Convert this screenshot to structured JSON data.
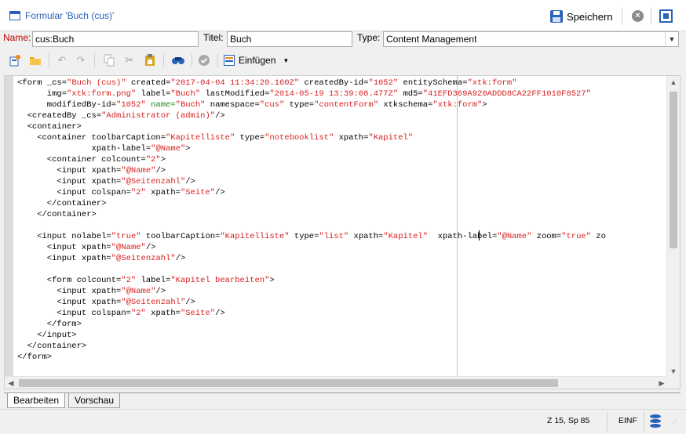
{
  "window": {
    "title": "Formular 'Buch (cus)'",
    "save_label": "Speichern",
    "icons": [
      "form-window-icon",
      "save-icon",
      "close-circle-icon",
      "fit-window-icon"
    ]
  },
  "fields": {
    "name_label": "Name:",
    "name_value": "cus:Buch",
    "title_label": "Titel:",
    "title_value": "Buch",
    "type_label": "Type:",
    "type_value": "Content Management"
  },
  "toolbar": {
    "insert_label": "Einfügen",
    "icons": [
      "new-element-icon",
      "open-folder-icon",
      "undo-icon",
      "redo-icon",
      "copy-icon",
      "cut-icon",
      "paste-icon",
      "find-icon",
      "validate-icon",
      "insert-icon",
      "dropdown-arrow-icon"
    ]
  },
  "code_lines": [
    [
      {
        "t": "<form _cs=",
        "c": "k"
      },
      {
        "t": "\"Buch (cus)\"",
        "c": "s"
      },
      {
        "t": " created=",
        "c": "k"
      },
      {
        "t": "\"2017-04-04 11:34:20.160Z\"",
        "c": "s"
      },
      {
        "t": " createdBy-id=",
        "c": "k"
      },
      {
        "t": "\"1052\"",
        "c": "s"
      },
      {
        "t": " entitySchema=",
        "c": "k"
      },
      {
        "t": "\"xtk:form\"",
        "c": "s"
      }
    ],
    [
      {
        "t": "      img=",
        "c": "k"
      },
      {
        "t": "\"xtk:form.png\"",
        "c": "s"
      },
      {
        "t": " label=",
        "c": "k"
      },
      {
        "t": "\"Buch\"",
        "c": "s"
      },
      {
        "t": " lastModified=",
        "c": "k"
      },
      {
        "t": "\"2014-05-19 13:39:08.477Z\"",
        "c": "s"
      },
      {
        "t": " md5=",
        "c": "k"
      },
      {
        "t": "\"41EFD369A920ADDD8CA22FF1010F8527\"",
        "c": "s"
      }
    ],
    [
      {
        "t": "      modifiedBy-id=",
        "c": "k"
      },
      {
        "t": "\"1052\"",
        "c": "s"
      },
      {
        "t": " name=",
        "c": "g"
      },
      {
        "t": "\"Buch\"",
        "c": "s"
      },
      {
        "t": " namespace=",
        "c": "k"
      },
      {
        "t": "\"cus\"",
        "c": "s"
      },
      {
        "t": " type=",
        "c": "k"
      },
      {
        "t": "\"contentForm\"",
        "c": "s"
      },
      {
        "t": " xtkschema=",
        "c": "k"
      },
      {
        "t": "\"xtk:form\"",
        "c": "s"
      },
      {
        "t": ">",
        "c": "k"
      }
    ],
    [
      {
        "t": "  <createdBy _cs=",
        "c": "k"
      },
      {
        "t": "\"Administrator (admin)\"",
        "c": "s"
      },
      {
        "t": "/>",
        "c": "k"
      }
    ],
    [
      {
        "t": "  <container>",
        "c": "k"
      }
    ],
    [
      {
        "t": "    <container toolbarCaption=",
        "c": "k"
      },
      {
        "t": "\"Kapitelliste\"",
        "c": "s"
      },
      {
        "t": " type=",
        "c": "k"
      },
      {
        "t": "\"notebooklist\"",
        "c": "s"
      },
      {
        "t": " xpath=",
        "c": "k"
      },
      {
        "t": "\"Kapitel\"",
        "c": "s"
      }
    ],
    [
      {
        "t": "               xpath-label=",
        "c": "k"
      },
      {
        "t": "\"@Name\"",
        "c": "s"
      },
      {
        "t": ">",
        "c": "k"
      }
    ],
    [
      {
        "t": "      <container colcount=",
        "c": "k"
      },
      {
        "t": "\"2\"",
        "c": "s"
      },
      {
        "t": ">",
        "c": "k"
      }
    ],
    [
      {
        "t": "        <input xpath=",
        "c": "k"
      },
      {
        "t": "\"@Name\"",
        "c": "s"
      },
      {
        "t": "/>",
        "c": "k"
      }
    ],
    [
      {
        "t": "        <input xpath=",
        "c": "k"
      },
      {
        "t": "\"@Seitenzahl\"",
        "c": "s"
      },
      {
        "t": "/>",
        "c": "k"
      }
    ],
    [
      {
        "t": "        <input colspan=",
        "c": "k"
      },
      {
        "t": "\"2\"",
        "c": "s"
      },
      {
        "t": " xpath=",
        "c": "k"
      },
      {
        "t": "\"Seite\"",
        "c": "s"
      },
      {
        "t": "/>",
        "c": "k"
      }
    ],
    [
      {
        "t": "      </container>",
        "c": "k"
      }
    ],
    [
      {
        "t": "    </container>",
        "c": "k"
      }
    ],
    [
      {
        "t": "",
        "c": "k"
      }
    ],
    [
      {
        "t": "    <input nolabel=",
        "c": "k"
      },
      {
        "t": "\"true\"",
        "c": "s"
      },
      {
        "t": " toolbarCaption=",
        "c": "k"
      },
      {
        "t": "\"Kapitelliste\"",
        "c": "s"
      },
      {
        "t": " type=",
        "c": "k"
      },
      {
        "t": "\"list\"",
        "c": "s"
      },
      {
        "t": " xpath=",
        "c": "k"
      },
      {
        "t": "\"Kapitel\"",
        "c": "s"
      },
      {
        "t": "  xpath-label=",
        "c": "k"
      },
      {
        "t": "\"@Name\"",
        "c": "s"
      },
      {
        "t": " zoom=",
        "c": "k"
      },
      {
        "t": "\"true\"",
        "c": "s"
      },
      {
        "t": " zo",
        "c": "k"
      }
    ],
    [
      {
        "t": "      <input xpath=",
        "c": "k"
      },
      {
        "t": "\"@Name\"",
        "c": "s"
      },
      {
        "t": "/>",
        "c": "k"
      }
    ],
    [
      {
        "t": "      <input xpath=",
        "c": "k"
      },
      {
        "t": "\"@Seitenzahl\"",
        "c": "s"
      },
      {
        "t": "/>",
        "c": "k"
      }
    ],
    [
      {
        "t": "",
        "c": "k"
      }
    ],
    [
      {
        "t": "      <form colcount=",
        "c": "k"
      },
      {
        "t": "\"2\"",
        "c": "s"
      },
      {
        "t": " label=",
        "c": "k"
      },
      {
        "t": "\"Kapitel bearbeiten\"",
        "c": "s"
      },
      {
        "t": ">",
        "c": "k"
      }
    ],
    [
      {
        "t": "        <input xpath=",
        "c": "k"
      },
      {
        "t": "\"@Name\"",
        "c": "s"
      },
      {
        "t": "/>",
        "c": "k"
      }
    ],
    [
      {
        "t": "        <input xpath=",
        "c": "k"
      },
      {
        "t": "\"@Seitenzahl\"",
        "c": "s"
      },
      {
        "t": "/>",
        "c": "k"
      }
    ],
    [
      {
        "t": "        <input colspan=",
        "c": "k"
      },
      {
        "t": "\"2\"",
        "c": "s"
      },
      {
        "t": " xpath=",
        "c": "k"
      },
      {
        "t": "\"Seite\"",
        "c": "s"
      },
      {
        "t": "/>",
        "c": "k"
      }
    ],
    [
      {
        "t": "      </form>",
        "c": "k"
      }
    ],
    [
      {
        "t": "    </input>",
        "c": "k"
      }
    ],
    [
      {
        "t": "  </container>",
        "c": "k"
      }
    ],
    [
      {
        "t": "</form>",
        "c": "k"
      }
    ]
  ],
  "tabs": [
    {
      "label": "Bearbeiten",
      "active": true
    },
    {
      "label": "Vorschau",
      "active": false
    }
  ],
  "status": {
    "position": "Z 15, Sp 85",
    "mode": "EINF",
    "icons": [
      "database-icon",
      "resize-grip-icon"
    ]
  },
  "colors": {
    "accent": "#2a62b8",
    "string": "#d81e1e",
    "attribute_highlight": "#1a8a1a",
    "required_label": "#c00000"
  }
}
